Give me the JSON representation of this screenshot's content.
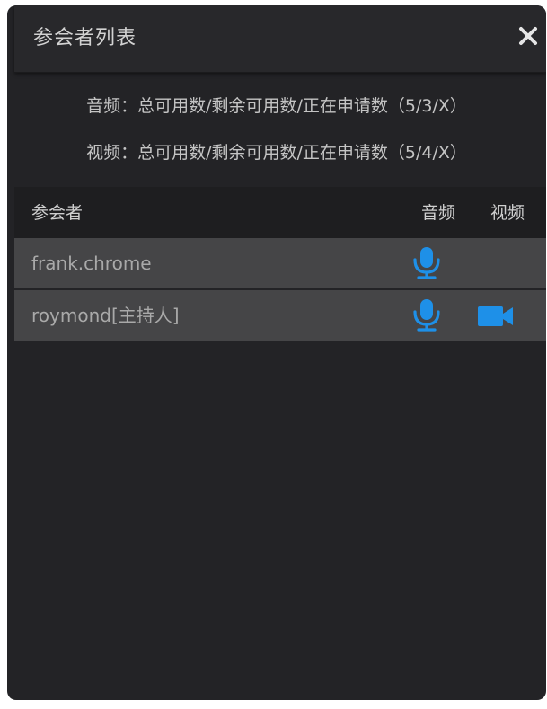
{
  "panel": {
    "title": "参会者列表",
    "close_icon": "close-icon"
  },
  "stats": {
    "audio": "音频：总可用数/剩余可用数/正在申请数（5/3/X）",
    "video": "视频：总可用数/剩余可用数/正在申请数（5/4/X）"
  },
  "list": {
    "headers": {
      "name": "参会者",
      "audio": "音频",
      "video": "视频"
    },
    "rows": [
      {
        "name": "frank.chrome",
        "audio_icon": "microphone-icon",
        "video_icon": ""
      },
      {
        "name": "roymond[主持人]",
        "audio_icon": "microphone-icon",
        "video_icon": "video-camera-icon"
      }
    ]
  },
  "colors": {
    "panel_bg": "#232326",
    "header_bg": "#28282b",
    "list_header_bg": "#1e1e20",
    "row_bg": "#454547",
    "accent": "#1e90e8"
  }
}
